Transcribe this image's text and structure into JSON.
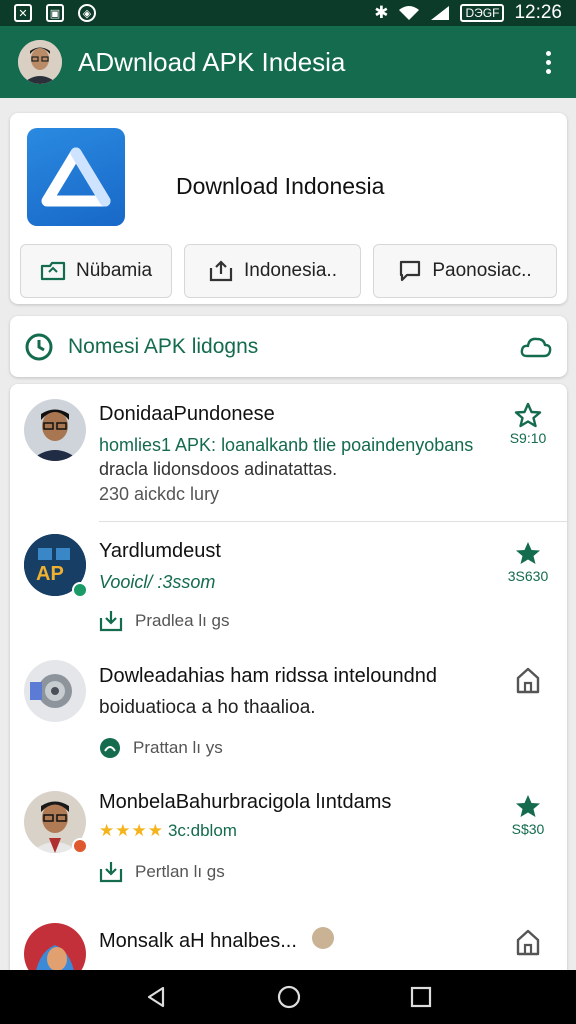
{
  "status_bar": {
    "time": "12:26",
    "battery": "DЭGF"
  },
  "app_bar": {
    "title": "ADwnload APK Indesia"
  },
  "header": {
    "app_name": "Download Indonesia",
    "actions": [
      "Nübamia",
      "Indonesia..",
      "Paonosiac.."
    ]
  },
  "section": {
    "title": "Nomesi APK lidogns"
  },
  "items": [
    {
      "title": "DonidaaPundonese",
      "line1": "homlies1 APK: loanalkanb tlie poaindenyobans",
      "line2": "dracla lidonsdoos adinatattas.",
      "line3": "230 aickdc lury",
      "trail": "S9:10"
    },
    {
      "title": "Yardlumdeust",
      "line1": "Vooicl/ :3ssom",
      "meta": "Pradlea lı gs",
      "trail": "3S630"
    },
    {
      "title": "Dowleadahias ham ridssa inteloundnd",
      "line1": "boiduatioca a ho thaalioa.",
      "meta": "Prattan lı ys"
    },
    {
      "title": "MonbelaBahurbracigola lıntdams",
      "line1": "3c:dblom",
      "meta": "Pertlan lı gs",
      "trail": "S$30"
    },
    {
      "title": "Monsalk aH hnalbes..."
    }
  ],
  "colors": {
    "primary": "#146b4e",
    "status_bar": "#0d3b2a",
    "star": "#f3b51b"
  }
}
